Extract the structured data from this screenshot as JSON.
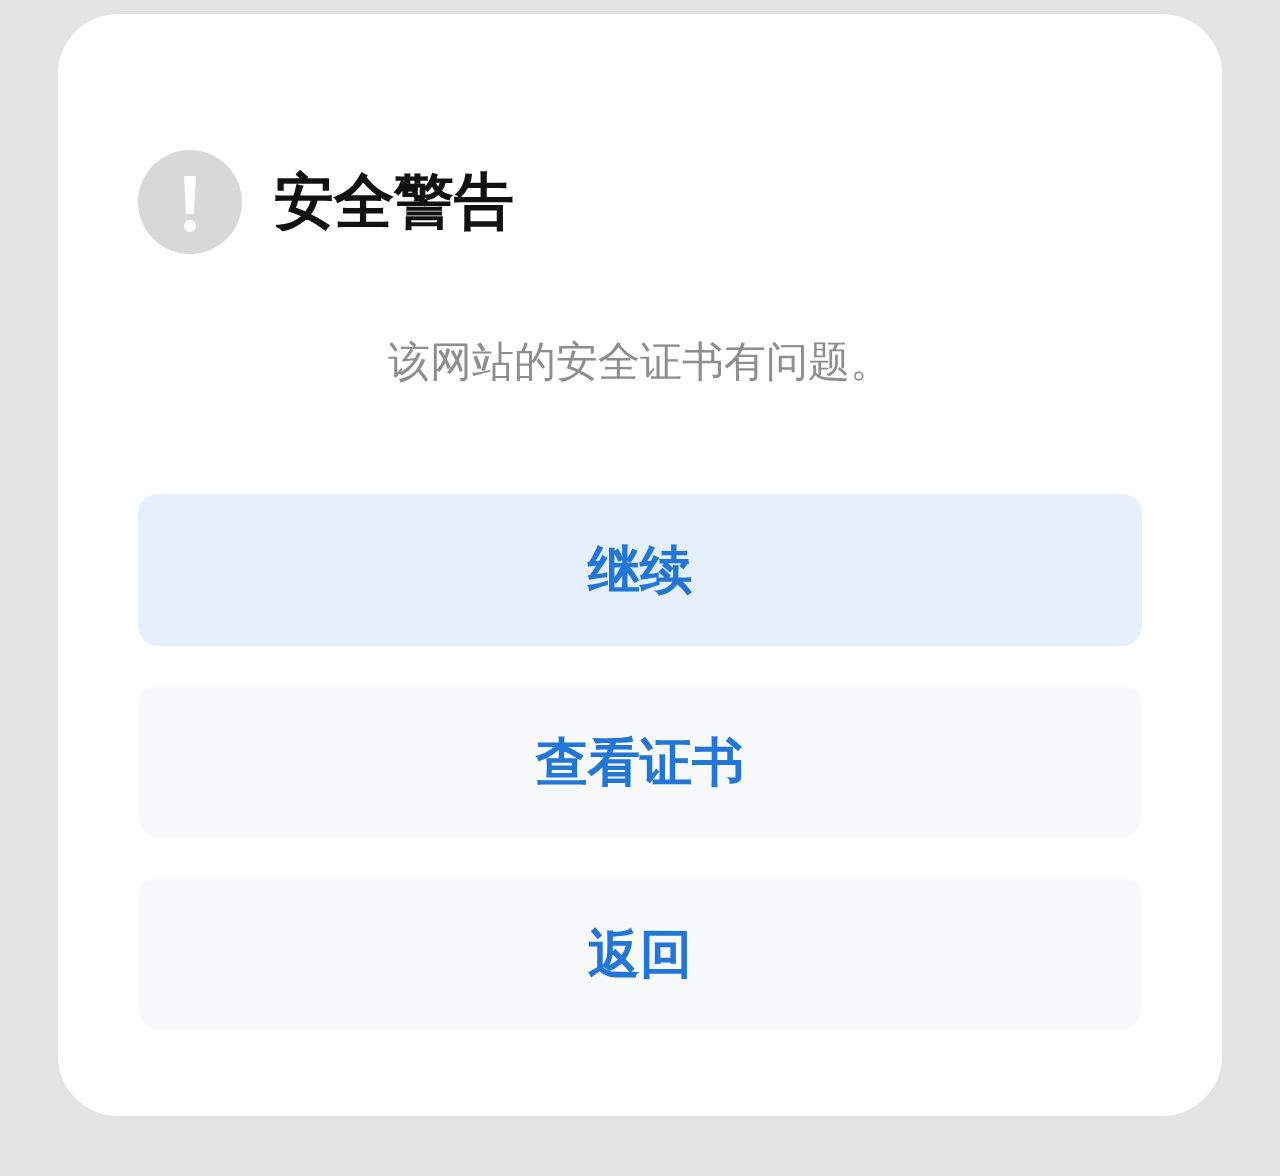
{
  "dialog": {
    "title": "安全警告",
    "message": "该网站的安全证书有问题。",
    "buttons": [
      {
        "label": "继续",
        "selected": true
      },
      {
        "label": "查看证书",
        "selected": false
      },
      {
        "label": "返回",
        "selected": false
      }
    ]
  }
}
